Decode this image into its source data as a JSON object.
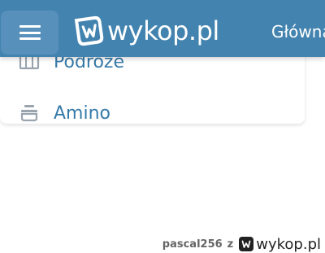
{
  "header": {
    "menu_button_icon": "hamburger-icon",
    "logo_icon": "wykop-logo-icon",
    "logo_text": "wykop.pl",
    "nav_link": "Główna",
    "colors": {
      "header_bg": "#4383af",
      "menu_button_bg": "#5790bb",
      "text": "#ffffff"
    }
  },
  "menu": {
    "items": [
      {
        "label": "Podróże",
        "icon": "map-icon"
      },
      {
        "label": "Amino",
        "icon": "bowl-icon"
      }
    ],
    "label_color": "#367aa9"
  },
  "credit": {
    "user": "pascal256",
    "joiner": "z",
    "logo_icon": "wykop-logo-icon",
    "logo_text": "wykop.pl"
  }
}
